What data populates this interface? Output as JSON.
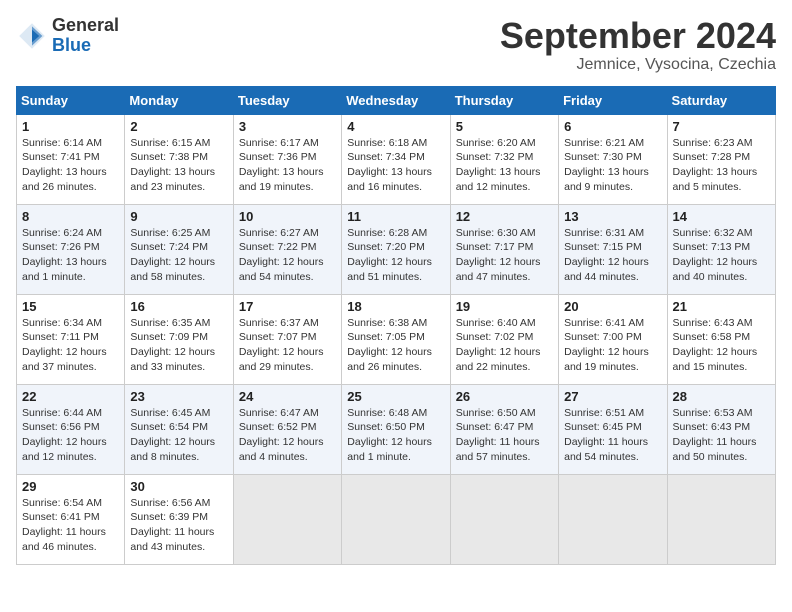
{
  "logo": {
    "general": "General",
    "blue": "Blue"
  },
  "title": {
    "month": "September 2024",
    "location": "Jemnice, Vysocina, Czechia"
  },
  "headers": [
    "Sunday",
    "Monday",
    "Tuesday",
    "Wednesday",
    "Thursday",
    "Friday",
    "Saturday"
  ],
  "weeks": [
    [
      {
        "day": "1",
        "info": "Sunrise: 6:14 AM\nSunset: 7:41 PM\nDaylight: 13 hours\nand 26 minutes."
      },
      {
        "day": "2",
        "info": "Sunrise: 6:15 AM\nSunset: 7:38 PM\nDaylight: 13 hours\nand 23 minutes."
      },
      {
        "day": "3",
        "info": "Sunrise: 6:17 AM\nSunset: 7:36 PM\nDaylight: 13 hours\nand 19 minutes."
      },
      {
        "day": "4",
        "info": "Sunrise: 6:18 AM\nSunset: 7:34 PM\nDaylight: 13 hours\nand 16 minutes."
      },
      {
        "day": "5",
        "info": "Sunrise: 6:20 AM\nSunset: 7:32 PM\nDaylight: 13 hours\nand 12 minutes."
      },
      {
        "day": "6",
        "info": "Sunrise: 6:21 AM\nSunset: 7:30 PM\nDaylight: 13 hours\nand 9 minutes."
      },
      {
        "day": "7",
        "info": "Sunrise: 6:23 AM\nSunset: 7:28 PM\nDaylight: 13 hours\nand 5 minutes."
      }
    ],
    [
      {
        "day": "8",
        "info": "Sunrise: 6:24 AM\nSunset: 7:26 PM\nDaylight: 13 hours\nand 1 minute."
      },
      {
        "day": "9",
        "info": "Sunrise: 6:25 AM\nSunset: 7:24 PM\nDaylight: 12 hours\nand 58 minutes."
      },
      {
        "day": "10",
        "info": "Sunrise: 6:27 AM\nSunset: 7:22 PM\nDaylight: 12 hours\nand 54 minutes."
      },
      {
        "day": "11",
        "info": "Sunrise: 6:28 AM\nSunset: 7:20 PM\nDaylight: 12 hours\nand 51 minutes."
      },
      {
        "day": "12",
        "info": "Sunrise: 6:30 AM\nSunset: 7:17 PM\nDaylight: 12 hours\nand 47 minutes."
      },
      {
        "day": "13",
        "info": "Sunrise: 6:31 AM\nSunset: 7:15 PM\nDaylight: 12 hours\nand 44 minutes."
      },
      {
        "day": "14",
        "info": "Sunrise: 6:32 AM\nSunset: 7:13 PM\nDaylight: 12 hours\nand 40 minutes."
      }
    ],
    [
      {
        "day": "15",
        "info": "Sunrise: 6:34 AM\nSunset: 7:11 PM\nDaylight: 12 hours\nand 37 minutes."
      },
      {
        "day": "16",
        "info": "Sunrise: 6:35 AM\nSunset: 7:09 PM\nDaylight: 12 hours\nand 33 minutes."
      },
      {
        "day": "17",
        "info": "Sunrise: 6:37 AM\nSunset: 7:07 PM\nDaylight: 12 hours\nand 29 minutes."
      },
      {
        "day": "18",
        "info": "Sunrise: 6:38 AM\nSunset: 7:05 PM\nDaylight: 12 hours\nand 26 minutes."
      },
      {
        "day": "19",
        "info": "Sunrise: 6:40 AM\nSunset: 7:02 PM\nDaylight: 12 hours\nand 22 minutes."
      },
      {
        "day": "20",
        "info": "Sunrise: 6:41 AM\nSunset: 7:00 PM\nDaylight: 12 hours\nand 19 minutes."
      },
      {
        "day": "21",
        "info": "Sunrise: 6:43 AM\nSunset: 6:58 PM\nDaylight: 12 hours\nand 15 minutes."
      }
    ],
    [
      {
        "day": "22",
        "info": "Sunrise: 6:44 AM\nSunset: 6:56 PM\nDaylight: 12 hours\nand 12 minutes."
      },
      {
        "day": "23",
        "info": "Sunrise: 6:45 AM\nSunset: 6:54 PM\nDaylight: 12 hours\nand 8 minutes."
      },
      {
        "day": "24",
        "info": "Sunrise: 6:47 AM\nSunset: 6:52 PM\nDaylight: 12 hours\nand 4 minutes."
      },
      {
        "day": "25",
        "info": "Sunrise: 6:48 AM\nSunset: 6:50 PM\nDaylight: 12 hours\nand 1 minute."
      },
      {
        "day": "26",
        "info": "Sunrise: 6:50 AM\nSunset: 6:47 PM\nDaylight: 11 hours\nand 57 minutes."
      },
      {
        "day": "27",
        "info": "Sunrise: 6:51 AM\nSunset: 6:45 PM\nDaylight: 11 hours\nand 54 minutes."
      },
      {
        "day": "28",
        "info": "Sunrise: 6:53 AM\nSunset: 6:43 PM\nDaylight: 11 hours\nand 50 minutes."
      }
    ],
    [
      {
        "day": "29",
        "info": "Sunrise: 6:54 AM\nSunset: 6:41 PM\nDaylight: 11 hours\nand 46 minutes."
      },
      {
        "day": "30",
        "info": "Sunrise: 6:56 AM\nSunset: 6:39 PM\nDaylight: 11 hours\nand 43 minutes."
      },
      {
        "day": "",
        "info": ""
      },
      {
        "day": "",
        "info": ""
      },
      {
        "day": "",
        "info": ""
      },
      {
        "day": "",
        "info": ""
      },
      {
        "day": "",
        "info": ""
      }
    ]
  ]
}
